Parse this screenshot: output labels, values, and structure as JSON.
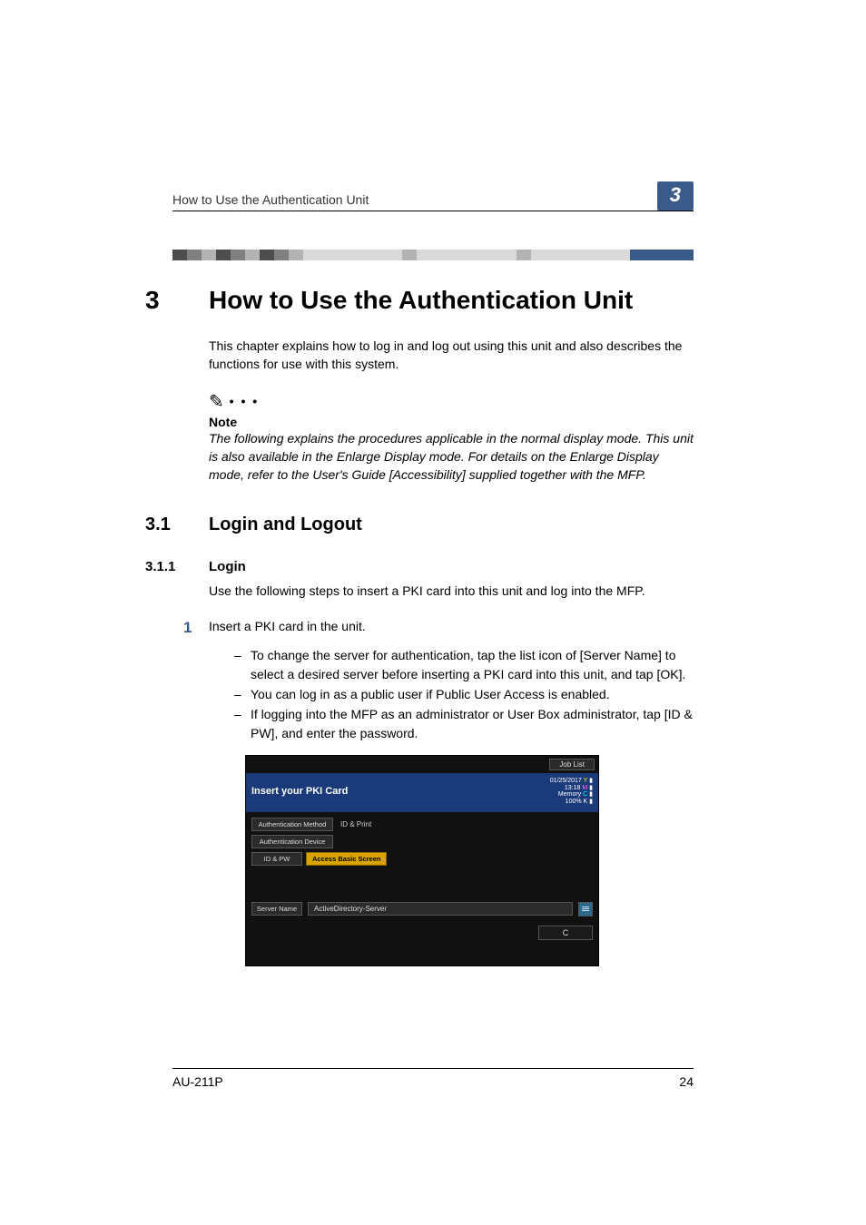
{
  "running_header": "How to Use the Authentication Unit",
  "chapter_badge": "3",
  "chapter": {
    "number": "3",
    "title": "How to Use the Authentication Unit"
  },
  "intro_paragraph": "This chapter explains how to log in and log out using this unit and also describes the functions for use with this system.",
  "note": {
    "label": "Note",
    "body": "The following explains the procedures applicable in the normal display mode. This unit is also available in the Enlarge Display mode. For details on the Enlarge Display mode, refer to the User's Guide [Accessibility] supplied together with the MFP."
  },
  "section": {
    "number": "3.1",
    "title": "Login and Logout"
  },
  "subsection": {
    "number": "3.1.1",
    "title": "Login",
    "intro": "Use the following steps to insert a PKI card into this unit and log into the MFP."
  },
  "step1": {
    "number": "1",
    "text": "Insert a PKI card in the unit.",
    "bullets": [
      "To change the server for authentication, tap the list icon of [Server Name] to select a desired server before inserting a PKI card into this unit, and tap [OK].",
      "You can log in as a public user if Public User Access is enabled.",
      "If logging into the MFP as an administrator or User Box administrator, tap [ID & PW], and enter the password."
    ]
  },
  "mfp": {
    "job_list": "Job List",
    "banner": "Insert your PKI Card",
    "status_date": "01/25/2017",
    "status_time": "13:18",
    "status_memory": "Memory",
    "status_pct": "100%",
    "auth_method_label": "Authentication Method",
    "id_print": "ID & Print",
    "auth_device_label": "Authentication Device",
    "id_pw": "ID & PW",
    "access_basic": "Access Basic Screen",
    "server_name_label": "Server Name",
    "server_value": "ActiveDirectory-Server",
    "c_button": "C"
  },
  "footer": {
    "model": "AU-211P",
    "page": "24"
  }
}
